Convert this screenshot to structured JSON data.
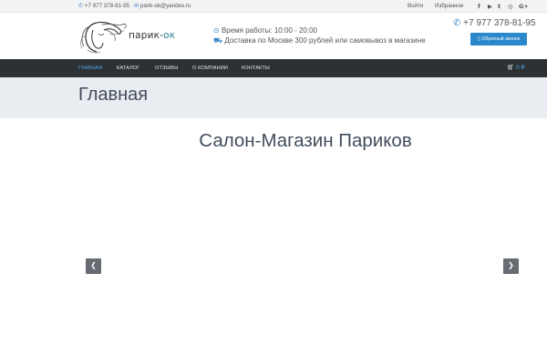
{
  "topbar": {
    "phone": "+7 977 378-81-95",
    "email": "parik-ok@yandex.ru",
    "login": "Войти",
    "favorites": "Избранное",
    "social": [
      "f",
      "▶",
      "t",
      "◎",
      "G+"
    ]
  },
  "header": {
    "logo_text_main": "парик-",
    "logo_text_accent": "ок",
    "hours": "Время работы: 10:00 - 20:00",
    "delivery": "Доставка по Москве 300 рублей или самовывоз в магазине",
    "phone": "+7 977 378-81-95",
    "callback_label": "Обратный звонок"
  },
  "nav": {
    "items": [
      {
        "label": "Главная",
        "active": true
      },
      {
        "label": "Каталог",
        "active": false
      },
      {
        "label": "Отзывы",
        "active": false
      },
      {
        "label": "О компании",
        "active": false
      },
      {
        "label": "Контакты",
        "active": false
      }
    ],
    "cart_total": "0 ₽"
  },
  "page": {
    "title": "Главная",
    "hero_title": "Салон-Магазин Париков"
  },
  "colors": {
    "accent": "#2a88cb",
    "nav_bg": "#2d3134",
    "title_band": "#e9ecf1",
    "logo_accent": "#2b7f95"
  },
  "icons": {
    "phone": "phone-icon",
    "email": "envelope-icon",
    "clock": "clock-icon",
    "car": "car-icon",
    "cart": "cart-icon",
    "prev": "chevron-left-icon",
    "next": "chevron-right-icon"
  }
}
